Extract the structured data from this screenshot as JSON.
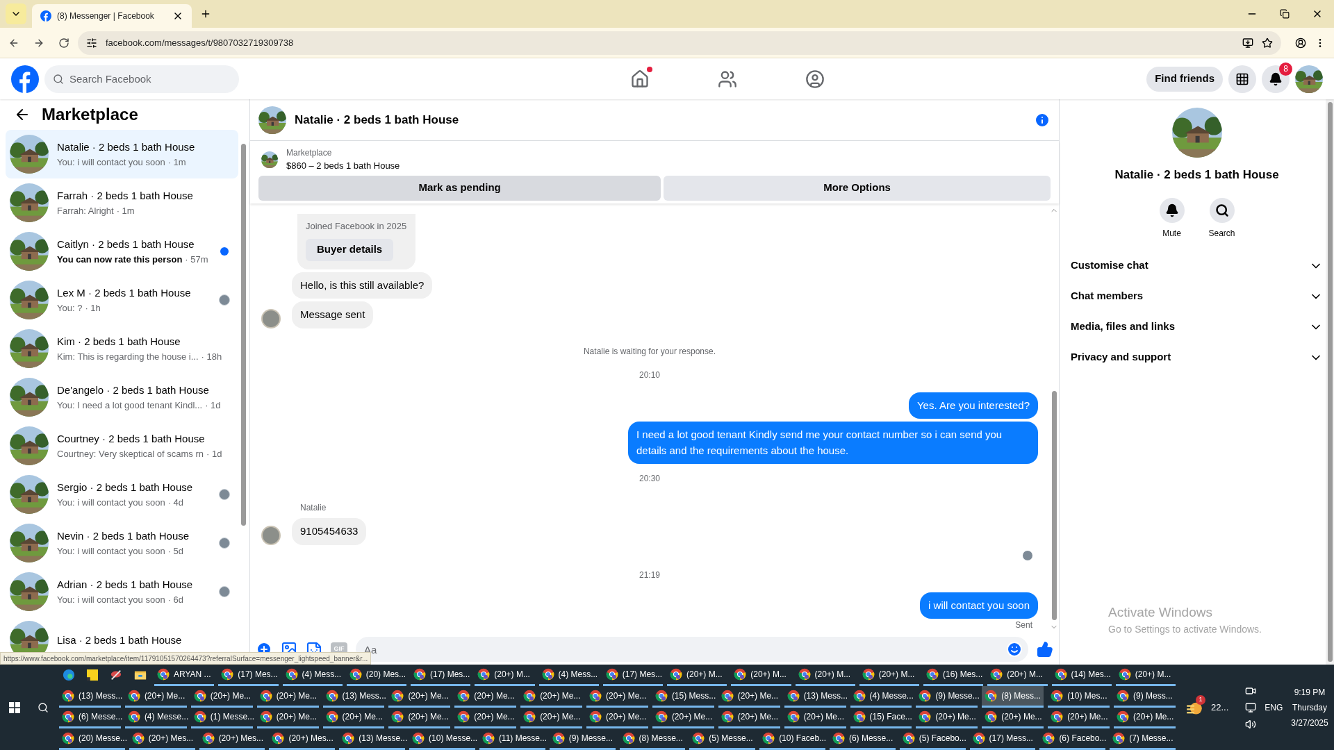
{
  "browser": {
    "tab": {
      "title": "(8) Messenger | Facebook",
      "selected": true
    },
    "url": "facebook.com/messages/t/9807032719309738",
    "status_url": "https://www.facebook.com/marketplace/item/11791051570264473?referralSurface=messenger_lightspeed_banner&r..."
  },
  "header": {
    "search": {
      "placeholder": "Search Facebook"
    },
    "home_notification": true,
    "find_friends": "Find friends",
    "notifications_badge": "8"
  },
  "sidebar": {
    "title": "Marketplace",
    "conversations": [
      {
        "title": "Natalie · 2 beds 1 bath House",
        "preview": "You: i will contact you soon",
        "time": "· 1m",
        "selected": true,
        "unread": false,
        "unread_dot": false,
        "seen_avatar": false
      },
      {
        "title": "Farrah · 2 beds 1 bath House",
        "preview": "Farrah: Alright",
        "time": "· 1m",
        "selected": false,
        "unread": false,
        "unread_dot": false,
        "seen_avatar": false
      },
      {
        "title": "Caitlyn · 2 beds 1 bath House",
        "preview": "You can now rate this person",
        "time": "· 57m",
        "selected": false,
        "unread": true,
        "unread_dot": true,
        "seen_avatar": false
      },
      {
        "title": "Lex M · 2 beds 1 bath House",
        "preview": "You: ?",
        "time": "· 1h",
        "selected": false,
        "unread": false,
        "unread_dot": false,
        "seen_avatar": true
      },
      {
        "title": "Kim · 2 beds 1 bath House",
        "preview": "Kim: This is regarding the house i...",
        "time": "· 18h",
        "selected": false,
        "unread": false,
        "unread_dot": false,
        "seen_avatar": false
      },
      {
        "title": "De'angelo · 2 beds 1 bath House",
        "preview": "You: I need a lot good tenant Kindl...",
        "time": "· 1d",
        "selected": false,
        "unread": false,
        "unread_dot": false,
        "seen_avatar": false
      },
      {
        "title": "Courtney · 2 beds 1 bath House",
        "preview": "Courtney: Very skeptical of scams rn",
        "time": "· 1d",
        "selected": false,
        "unread": false,
        "unread_dot": false,
        "seen_avatar": false
      },
      {
        "title": "Sergio · 2 beds 1 bath House",
        "preview": "You: i will contact you soon",
        "time": "· 4d",
        "selected": false,
        "unread": false,
        "unread_dot": false,
        "seen_avatar": true
      },
      {
        "title": "Nevin · 2 beds 1 bath House",
        "preview": "You: i will contact you soon",
        "time": "· 5d",
        "selected": false,
        "unread": false,
        "unread_dot": false,
        "seen_avatar": true
      },
      {
        "title": "Adrian · 2 beds 1 bath House",
        "preview": "You: i will contact you soon",
        "time": "· 6d",
        "selected": false,
        "unread": false,
        "unread_dot": false,
        "seen_avatar": true
      },
      {
        "title": "Lisa · 2 beds 1 bath House",
        "selected": false
      }
    ]
  },
  "chat": {
    "title": "Natalie · 2 beds 1 bath House",
    "listing": {
      "label": "Marketplace",
      "item": "$860 – 2 beds 1 bath House"
    },
    "actions": [
      "Mark as pending",
      "More Options"
    ],
    "messages": [
      {
        "kind": "card",
        "text": "Joined Facebook in 2025",
        "button": "Buyer details"
      },
      {
        "kind": "incoming",
        "text": "Hello, is this still available?",
        "avatar": false
      },
      {
        "kind": "incoming",
        "text": "Message sent",
        "avatar": true
      },
      {
        "kind": "notice",
        "text": "Natalie is waiting for your response."
      },
      {
        "kind": "time",
        "text": "20:10"
      },
      {
        "kind": "outgoing",
        "text": "Yes. Are you interested?"
      },
      {
        "kind": "outgoing",
        "text": "I need a lot good tenant Kindly send me your contact number so i can send you details and the requirements about the house."
      },
      {
        "kind": "time",
        "text": "20:30"
      },
      {
        "kind": "sender",
        "text": "Natalie"
      },
      {
        "kind": "incoming",
        "text": "9105454633",
        "avatar": true
      },
      {
        "kind": "seen"
      },
      {
        "kind": "time",
        "text": "21:19"
      },
      {
        "kind": "outgoing",
        "text": "i will contact you soon"
      },
      {
        "kind": "status",
        "text": "Sent"
      }
    ],
    "composer": {
      "gif_label": "GIF",
      "placeholder": "Aa"
    }
  },
  "details": {
    "name": "Natalie · 2 beds 1 bath House",
    "actions": [
      {
        "label": "Mute",
        "kind": "bell"
      },
      {
        "label": "Search",
        "kind": "search"
      }
    ],
    "sections": [
      {
        "label": "Customise chat",
        "expanded": false
      },
      {
        "label": "Chat members",
        "expanded": false
      },
      {
        "label": "Media, files and links",
        "expanded": false
      },
      {
        "label": "Privacy and support",
        "expanded": false
      }
    ]
  },
  "activation": {
    "title": "Activate Windows",
    "subtitle": "Go to Settings to activate Windows."
  },
  "taskbar": {
    "rows": [
      {
        "items": [
          {
            "label": "ARYAN ...",
            "selected": false
          },
          {
            "label": "(17) Mes...",
            "selected": false
          },
          {
            "label": "(4) Mess...",
            "selected": false
          },
          {
            "label": "(20) Mes...",
            "selected": false
          },
          {
            "label": "(17) Mes...",
            "selected": false
          },
          {
            "label": "(20+) M...",
            "selected": false
          },
          {
            "label": "(4) Mess...",
            "selected": false
          },
          {
            "label": "(17) Mes...",
            "selected": false
          },
          {
            "label": "(20+) M...",
            "selected": false
          },
          {
            "label": "(20+) M...",
            "selected": false
          },
          {
            "label": "(20+) M...",
            "selected": false
          },
          {
            "label": "(20+) M...",
            "selected": false
          },
          {
            "label": "(16) Mes...",
            "selected": false
          },
          {
            "label": "(20+) M...",
            "selected": false
          },
          {
            "label": "(14) Mes...",
            "selected": false
          },
          {
            "label": "(20+) M...",
            "selected": false
          }
        ]
      },
      {
        "items": [
          {
            "label": "(13) Mess...",
            "selected": false
          },
          {
            "label": "(20+) Me...",
            "selected": false
          },
          {
            "label": "(20+) Me...",
            "selected": false
          },
          {
            "label": "(20+) Me...",
            "selected": false
          },
          {
            "label": "(13) Mess...",
            "selected": false
          },
          {
            "label": "(20+) Me...",
            "selected": false
          },
          {
            "label": "(20+) Me...",
            "selected": false
          },
          {
            "label": "(20+) Me...",
            "selected": false
          },
          {
            "label": "(20+) Me...",
            "selected": false
          },
          {
            "label": "(15) Mess...",
            "selected": false
          },
          {
            "label": "(20+) Me...",
            "selected": false
          },
          {
            "label": "(13) Mess...",
            "selected": false
          },
          {
            "label": "(4) Messe...",
            "selected": false
          },
          {
            "label": "(9) Messe...",
            "selected": false
          },
          {
            "label": "(8) Mess...",
            "selected": true
          },
          {
            "label": "(10) Mes...",
            "selected": false
          },
          {
            "label": "(9) Mess...",
            "selected": false
          }
        ]
      },
      {
        "items": [
          {
            "label": "(6) Messe...",
            "selected": false
          },
          {
            "label": "(4) Messe...",
            "selected": false
          },
          {
            "label": "(1) Messe...",
            "selected": false
          },
          {
            "label": "(20+) Me...",
            "selected": false
          },
          {
            "label": "(20+) Me...",
            "selected": false
          },
          {
            "label": "(20+) Me...",
            "selected": false
          },
          {
            "label": "(20+) Me...",
            "selected": false
          },
          {
            "label": "(20+) Me...",
            "selected": false
          },
          {
            "label": "(20+) Me...",
            "selected": false
          },
          {
            "label": "(20+) Me...",
            "selected": false
          },
          {
            "label": "(20+) Me...",
            "selected": false
          },
          {
            "label": "(20+) Me...",
            "selected": false
          },
          {
            "label": "(15) Face...",
            "selected": false
          },
          {
            "label": "(20+) Me...",
            "selected": false
          },
          {
            "label": "(20+) Me...",
            "selected": false
          },
          {
            "label": "(20+) Me...",
            "selected": false
          },
          {
            "label": "(20+) Me...",
            "selected": false
          }
        ]
      },
      {
        "items": [
          {
            "label": "(20) Messe...",
            "selected": false
          },
          {
            "label": "(20+) Mes...",
            "selected": false
          },
          {
            "label": "(20+) Mes...",
            "selected": false
          },
          {
            "label": "(20+) Mes...",
            "selected": false
          },
          {
            "label": "(13) Messe...",
            "selected": false
          },
          {
            "label": "(10) Messe...",
            "selected": false
          },
          {
            "label": "(11) Messe...",
            "selected": false
          },
          {
            "label": "(9) Messe...",
            "selected": false
          },
          {
            "label": "(8) Messe...",
            "selected": false
          },
          {
            "label": "(5) Messe...",
            "selected": false
          },
          {
            "label": "(10) Faceb...",
            "selected": false
          },
          {
            "label": "(6) Messe...",
            "selected": false
          },
          {
            "label": "(5) Facebo...",
            "selected": false
          },
          {
            "label": "(17) Mess...",
            "selected": false
          },
          {
            "label": "(6) Facebo...",
            "selected": false
          },
          {
            "label": "(7) Messe...",
            "selected": false
          }
        ]
      }
    ],
    "weather": "22...",
    "weather_badge": "1",
    "language": "ENG",
    "time": "9:19 PM",
    "day": "Thursday",
    "date": "3/27/2025"
  }
}
